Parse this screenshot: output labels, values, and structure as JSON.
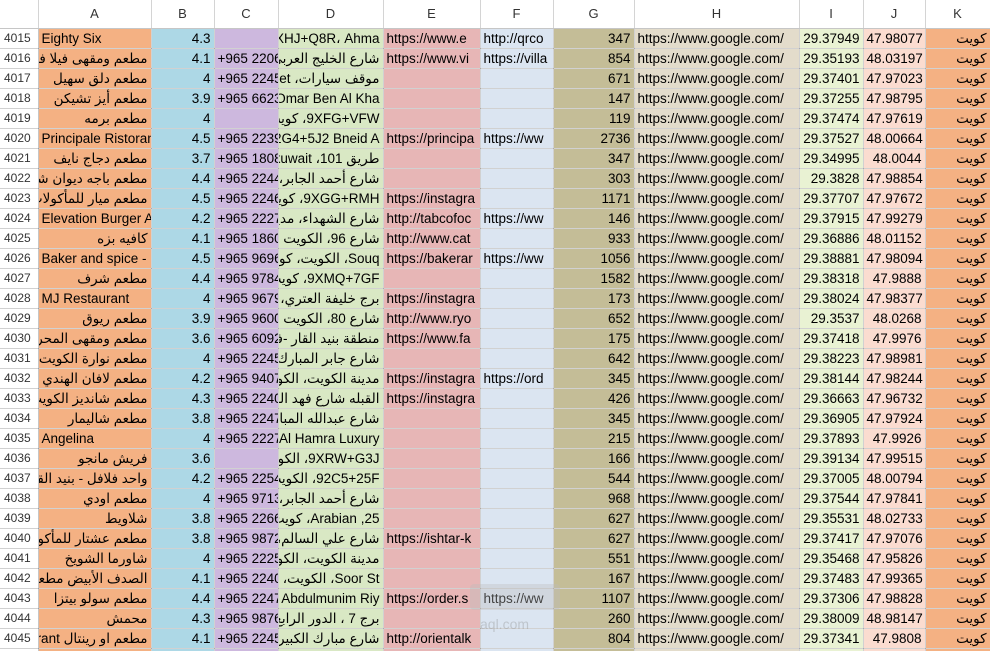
{
  "columns": [
    "A",
    "B",
    "C",
    "D",
    "E",
    "F",
    "G",
    "H",
    "I",
    "J",
    "K"
  ],
  "rows": [
    {
      "n": "4015",
      "a": "Eighty Six",
      "b": "4.3",
      "c": "",
      "d": "9XHJ+Q8R، Ahma",
      "e": "https://www.e",
      "f": "http://qrco",
      "g": "347",
      "h": "https://www.google.com/",
      "i": "29.37949",
      "j": "47.98077",
      "k": "كويت"
    },
    {
      "n": "4016",
      "a": "مطعم ومقهى فيلا فيرو",
      "b": "4.1",
      "c": "+965 2206",
      "d": "شارع الخليج العربي،",
      "e": "https://www.vi",
      "f": "https://villa",
      "g": "854",
      "h": "https://www.google.com/",
      "i": "29.35193",
      "j": "48.03197",
      "k": "كويت"
    },
    {
      "n": "4017",
      "a": "مطعم دلق سهيل",
      "b": "4",
      "c": "+965 2245",
      "d": "موقف سيارات، reet",
      "e": "",
      "f": "",
      "g": "671",
      "h": "https://www.google.com/",
      "i": "29.37401",
      "j": "47.97023",
      "k": "كويت"
    },
    {
      "n": "4018",
      "a": "مطعم أيز تشيكن",
      "b": "3.9",
      "c": "+965 6623",
      "d": "Omar Ben Al Kha",
      "e": "",
      "f": "",
      "g": "147",
      "h": "https://www.google.com/",
      "i": "29.37255",
      "j": "47.98795",
      "k": "كويت"
    },
    {
      "n": "4019",
      "a": "مطعم برمه",
      "b": "4",
      "c": "",
      "d": "9XFG+VFW، كويت",
      "e": "",
      "f": "",
      "g": "119",
      "h": "https://www.google.com/",
      "i": "29.37474",
      "j": "47.97619",
      "k": "كويت"
    },
    {
      "n": "4020",
      "a": "Principale Ristoran",
      "b": "4.5",
      "c": "+965 2239",
      "d": "92G4+5J2 Bneid A",
      "e": "https://principa",
      "f": "https://ww",
      "g": "2736",
      "h": "https://www.google.com/",
      "i": "29.37527",
      "j": "48.00664",
      "k": "كويت"
    },
    {
      "n": "4021",
      "a": "مطعم دجاج نايف",
      "b": "3.7",
      "c": "+965 1808",
      "d": "طريق 101، kuwait",
      "e": "",
      "f": "",
      "g": "347",
      "h": "https://www.google.com/",
      "i": "29.34995",
      "j": "48.0044",
      "k": "كويت"
    },
    {
      "n": "4022",
      "a": "مطعم باجه ديوان شرق",
      "b": "4.4",
      "c": "+965 2244",
      "d": "شارع أحمد الجابر، م",
      "e": "",
      "f": "",
      "g": "303",
      "h": "https://www.google.com/",
      "i": "29.3828",
      "j": "47.98854",
      "k": "كويت"
    },
    {
      "n": "4023",
      "a": "مطعم ميار للمأكولات ال",
      "b": "4.5",
      "c": "+965 2246",
      "d": "9XGG+RMH، كويت",
      "e": "https://instagra",
      "f": "",
      "g": "1171",
      "h": "https://www.google.com/",
      "i": "29.37707",
      "j": "47.97672",
      "k": "كويت"
    },
    {
      "n": "4024",
      "a": "Elevation Burger A",
      "b": "4.2",
      "c": "+965 2227",
      "d": "شارع الشهداء، مدينة",
      "e": "http://tabcofoc",
      "f": "https://ww",
      "g": "146",
      "h": "https://www.google.com/",
      "i": "29.37915",
      "j": "47.99279",
      "k": "كويت"
    },
    {
      "n": "4025",
      "a": "كافيه بزه",
      "b": "4.1",
      "c": "+965 1860",
      "d": "شارع 96، الكويت",
      "e": "http://www.cat",
      "f": "",
      "g": "933",
      "h": "https://www.google.com/",
      "i": "29.36886",
      "j": "48.01152",
      "k": "كويت"
    },
    {
      "n": "4026",
      "a": "Baker and spice -",
      "b": "4.5",
      "c": "+965 9696",
      "d": "Souq، الكويت، كويت",
      "e": "https://bakerar",
      "f": "https://ww",
      "g": "1056",
      "h": "https://www.google.com/",
      "i": "29.38881",
      "j": "47.98094",
      "k": "كويت"
    },
    {
      "n": "4027",
      "a": "مطعم شرف",
      "b": "4.4",
      "c": "+965 9784",
      "d": "9XMQ+7GF، كويت",
      "e": "",
      "f": "",
      "g": "1582",
      "h": "https://www.google.com/",
      "i": "29.38318",
      "j": "47.9888",
      "k": "كويت"
    },
    {
      "n": "4028",
      "a": "MJ Restaurant",
      "b": "4",
      "c": "+965 9679",
      "d": "برج خليفة العتري، 4",
      "e": "https://instagra",
      "f": "",
      "g": "173",
      "h": "https://www.google.com/",
      "i": "29.38024",
      "j": "47.98377",
      "k": "كويت"
    },
    {
      "n": "4029",
      "a": "مطعم ريوق",
      "b": "3.9",
      "c": "+965 9600",
      "d": "شارع 80، الكويت",
      "e": "http://www.ryo",
      "f": "",
      "g": "652",
      "h": "https://www.google.com/",
      "i": "29.3537",
      "j": "48.0268",
      "k": "كويت"
    },
    {
      "n": "4030",
      "a": "مطعم ومقهى المحروس",
      "b": "3.6",
      "c": "+965 6092",
      "d": "منطقة بنيد القار -فندق",
      "e": "https://www.fa",
      "f": "",
      "g": "175",
      "h": "https://www.google.com/",
      "i": "29.37418",
      "j": "47.9976",
      "k": "كويت"
    },
    {
      "n": "4031",
      "a": "مطعم نوارة الكويت",
      "b": "4",
      "c": "+965 2245",
      "d": "شارع جابر المبارك، ه",
      "e": "",
      "f": "",
      "g": "642",
      "h": "https://www.google.com/",
      "i": "29.38223",
      "j": "47.98981",
      "k": "كويت"
    },
    {
      "n": "4032",
      "a": "مطعم لافان الهندي",
      "b": "4.2",
      "c": "+965 9407",
      "d": "مدينة الكويت، الكويت",
      "e": "https://instagra",
      "f": "https://ord",
      "g": "345",
      "h": "https://www.google.com/",
      "i": "29.38144",
      "j": "47.98244",
      "k": "كويت"
    },
    {
      "n": "4033",
      "a": "مطعم شانديز الكويت",
      "b": "4.3",
      "c": "+965 2240",
      "d": "القبله شارع فهد السا",
      "e": "https://instagra",
      "f": "",
      "g": "426",
      "h": "https://www.google.com/",
      "i": "29.36663",
      "j": "47.96732",
      "k": "كويت"
    },
    {
      "n": "4034",
      "a": "مطعم شاليمار",
      "b": "3.8",
      "c": "+965 2247",
      "d": "شارع عبدالله المبارك",
      "e": "",
      "f": "",
      "g": "345",
      "h": "https://www.google.com/",
      "i": "29.36905",
      "j": "47.97924",
      "k": "كويت"
    },
    {
      "n": "4035",
      "a": "Angelina",
      "b": "4",
      "c": "+965 2227",
      "d": "Al Hamra Luxury",
      "e": "",
      "f": "",
      "g": "215",
      "h": "https://www.google.com/",
      "i": "29.37893",
      "j": "47.9926",
      "k": "كويت"
    },
    {
      "n": "4036",
      "a": "فريش مانجو",
      "b": "3.6",
      "c": "",
      "d": "9XRW+G3J، الكويت",
      "e": "",
      "f": "",
      "g": "166",
      "h": "https://www.google.com/",
      "i": "29.39134",
      "j": "47.99515",
      "k": "كويت"
    },
    {
      "n": "4037",
      "a": "واحد فلافل - بنيد القار",
      "b": "4.2",
      "c": "+965 2254",
      "d": "92C5+25F، الكويت",
      "e": "",
      "f": "",
      "g": "544",
      "h": "https://www.google.com/",
      "i": "29.37005",
      "j": "48.00794",
      "k": "كويت"
    },
    {
      "n": "4038",
      "a": "مطعم اودي",
      "b": "4",
      "c": "+965 9713",
      "d": "شارع أحمد الجابر، م",
      "e": "",
      "f": "",
      "g": "968",
      "h": "https://www.google.com/",
      "i": "29.37544",
      "j": "47.97841",
      "k": "كويت"
    },
    {
      "n": "4039",
      "a": "شلاويط",
      "b": "3.8",
      "c": "+965 2266",
      "d": "25, Arabian، كويت",
      "e": "",
      "f": "",
      "g": "627",
      "h": "https://www.google.com/",
      "i": "29.35531",
      "j": "48.02733",
      "k": "كويت"
    },
    {
      "n": "4040",
      "a": "مطعم عشتار للمأكولات",
      "b": "3.8",
      "c": "+965 9872",
      "d": "شارع علي السالم، مد",
      "e": "https://ishtar-k",
      "f": "",
      "g": "627",
      "h": "https://www.google.com/",
      "i": "29.37417",
      "j": "47.97076",
      "k": "كويت"
    },
    {
      "n": "4041",
      "a": "شاورما الشويخ",
      "b": "4",
      "c": "+965 2225",
      "d": "مدينة الكويت، الكويت",
      "e": "",
      "f": "",
      "g": "551",
      "h": "https://www.google.com/",
      "i": "29.35468",
      "j": "47.95826",
      "k": "كويت"
    },
    {
      "n": "4042",
      "a": "الصدف الأبيض مطعم",
      "b": "4.1",
      "c": "+965 2240",
      "d": "Soor St، الكويت، ت",
      "e": "",
      "f": "",
      "g": "167",
      "h": "https://www.google.com/",
      "i": "29.37483",
      "j": "47.99365",
      "k": "كويت"
    },
    {
      "n": "4043",
      "a": "مطعم سولو بيتزا",
      "b": "4.4",
      "c": "+965 2247",
      "d": "Abdulmunim Riy",
      "e": "https://order.s",
      "f": "https://ww",
      "g": "1107",
      "h": "https://www.google.com/",
      "i": "29.37306",
      "j": "47.98828",
      "k": "كويت"
    },
    {
      "n": "4044",
      "a": "محمش",
      "b": "4.3",
      "c": "+965 9876",
      "d": "برج 7 ، الدور الرابع ،",
      "e": "",
      "f": "",
      "g": "260",
      "h": "https://www.google.com/",
      "i": "29.38009",
      "j": "48.98147",
      "k": "كويت"
    },
    {
      "n": "4045",
      "a": "مطعم او رينتال aurant",
      "b": "4.1",
      "c": "+965 2245",
      "d": "شارع مبارك الكبير، م",
      "e": "http://orientalk",
      "f": "",
      "g": "804",
      "h": "https://www.google.com/",
      "i": "29.37341",
      "j": "47.9808",
      "k": "كويت"
    },
    {
      "n": "4046",
      "a": "",
      "b": "",
      "c": "",
      "d": "",
      "e": "",
      "f": "",
      "g": "",
      "h": "",
      "i": "",
      "j": "",
      "k": ""
    }
  ],
  "watermark": {
    "text": "aql.com"
  },
  "colors": {
    "colA": "#f4b183",
    "colB": "#add8e6",
    "colC": "#cdb8de",
    "colD": "#d9e8c4",
    "colE": "#e7b6b6",
    "colF": "#dbe5f1",
    "colG": "#c4bd97",
    "colH": "#e3dccb",
    "colI": "#e9f2d3",
    "colJ": "#fbdcd0",
    "colK": "#f4b183"
  }
}
